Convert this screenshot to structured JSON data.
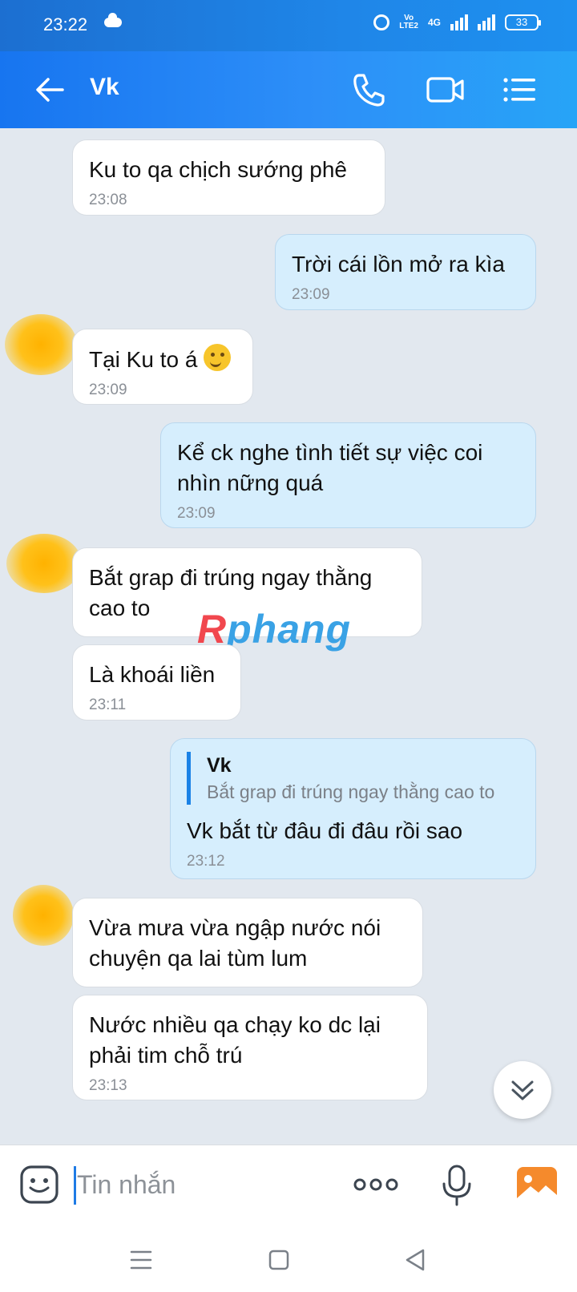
{
  "status_bar": {
    "time": "23:22",
    "volte_line1": "Vo",
    "volte_line2": "LTE2",
    "network": "4G",
    "battery": "33"
  },
  "header": {
    "title": "Vk"
  },
  "messages": [
    {
      "direction": "incoming",
      "text": "Ku to qa chịch sướng phê",
      "time": "23:08"
    },
    {
      "direction": "outgoing",
      "text": "Trời cái lồn mở ra kìa",
      "time": "23:09"
    },
    {
      "direction": "incoming",
      "text": "Tại Ku to á",
      "emoji": "smirk-face",
      "time": "23:09",
      "has_avatar": true
    },
    {
      "direction": "outgoing",
      "text": "Kể ck nghe tình tiết sự việc coi\nnhìn nững quá",
      "time": "23:09"
    },
    {
      "direction": "incoming",
      "text": "Bắt grap đi trúng ngay thằng\ncao to",
      "has_avatar": true
    },
    {
      "direction": "incoming",
      "text": "Là khoái liền",
      "time": "23:11"
    },
    {
      "direction": "outgoing",
      "quote": {
        "name": "Vk",
        "text": "Bắt grap đi trúng ngay thằng cao to"
      },
      "text": "Vk bắt từ đâu đi đâu rồi sao",
      "time": "23:12"
    },
    {
      "direction": "incoming",
      "text": "Vừa mưa vừa ngập nước nói\nchuyện qa lai tùm lum",
      "has_avatar": true
    },
    {
      "direction": "incoming",
      "text": "Nước nhiều qa chạy ko dc lại\nphải tim chỗ trú",
      "time": "23:13"
    }
  ],
  "watermark": {
    "first": "R",
    "rest": "phang"
  },
  "composer": {
    "placeholder": "Tin nhắn"
  },
  "colors": {
    "header_gradient_start": "#1775f0",
    "header_gradient_end": "#27a4f7",
    "outgoing_bubble": "#d6eefd",
    "incoming_bubble": "#ffffff",
    "chat_background": "#e2e8ef"
  },
  "icons": {
    "back": "arrow-left-icon",
    "call": "phone-icon",
    "video": "video-camera-icon",
    "menu": "list-icon",
    "sticker": "smiley-icon",
    "more": "three-dots-icon",
    "mic": "microphone-icon",
    "image": "image-icon",
    "scroll": "double-chevron-down-icon"
  }
}
